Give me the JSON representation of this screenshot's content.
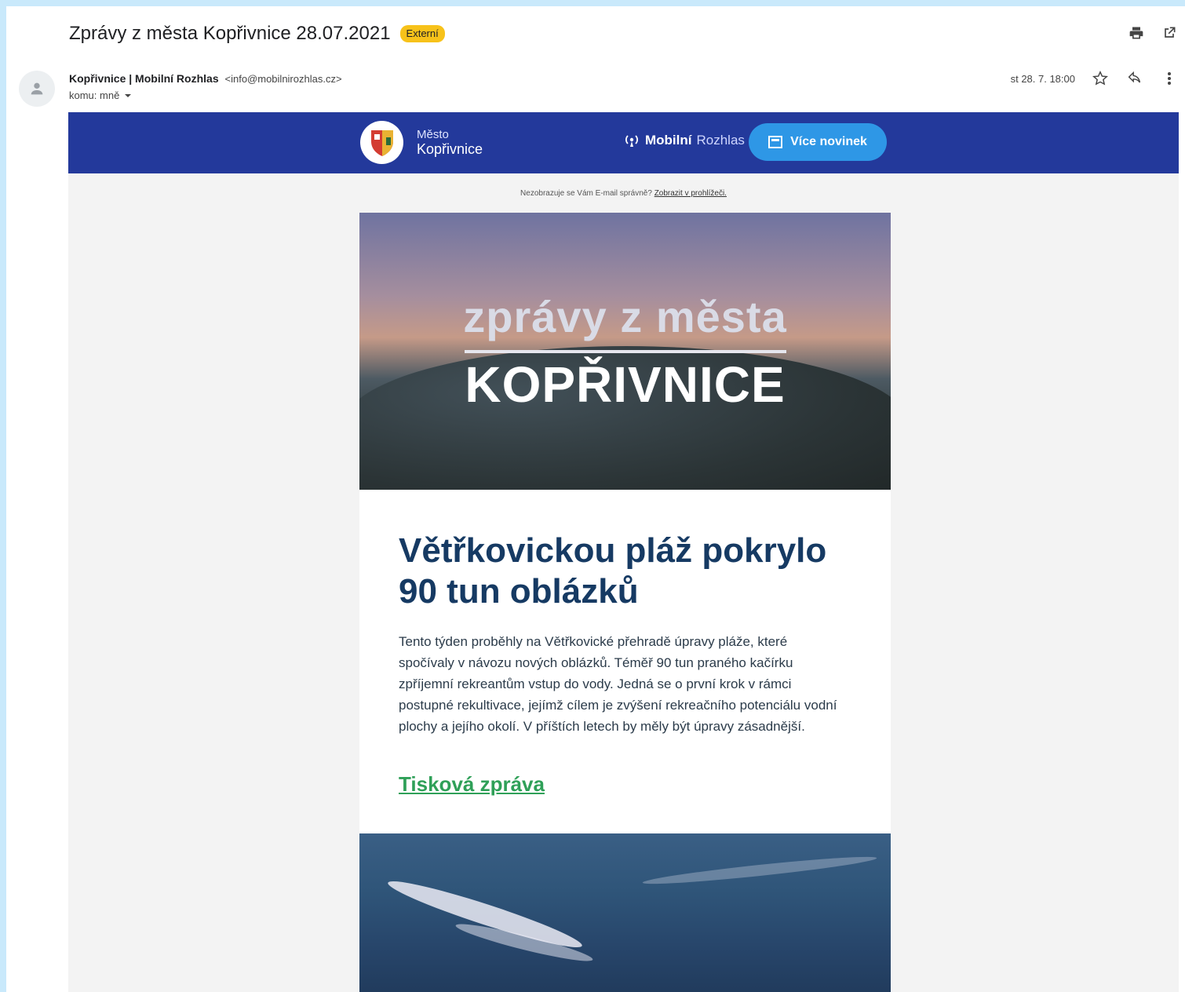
{
  "email": {
    "subject": "Zprávy z města Kopřivnice 28.07.2021",
    "badge": "Externí",
    "sender_name": "Kopřivnice | Mobilní Rozhlas",
    "sender_email": "<info@mobilnirozhlas.cz>",
    "to": "komu: mně",
    "date": "st 28. 7. 18:00"
  },
  "icons": {
    "print": "print-icon",
    "open_new": "open-in-new-icon",
    "star": "star-icon",
    "reply": "reply-icon",
    "more": "more-vert-icon"
  },
  "newsletter": {
    "logo_line1": "Město",
    "logo_line2": "Kopřivnice",
    "brand_bold": "Mobilní",
    "brand_light": "Rozhlas",
    "more_button": "Více novinek",
    "notice_text": "Nezobrazuje se Vám E-mail správně?",
    "notice_link": "Zobrazit v prohlížeči.",
    "hero_line1": "zprávy z města",
    "hero_line2": "KOPŘIVNICE",
    "article_title": "Větřkovickou pláž pokrylo 90 tun oblázků",
    "article_body": "Tento týden proběhly na Větřkovické přehradě úpravy pláže, které spočívaly v návozu nových oblázků. Téměř 90 tun praného kačírku zpříjemní rekreantům vstup do vody. Jedná se o první krok v rámci postupné rekultivace, jejímž cílem je zvýšení rekreačního potenciálu vodní plochy a jejího okolí. V příštích letech by měly být úpravy zásadnější.",
    "article_link": "Tisková zpráva"
  },
  "colors": {
    "banner": "#23399b",
    "button": "#2e97e6",
    "title": "#163a63",
    "link": "#2fa058",
    "badge": "#f7c21a"
  }
}
